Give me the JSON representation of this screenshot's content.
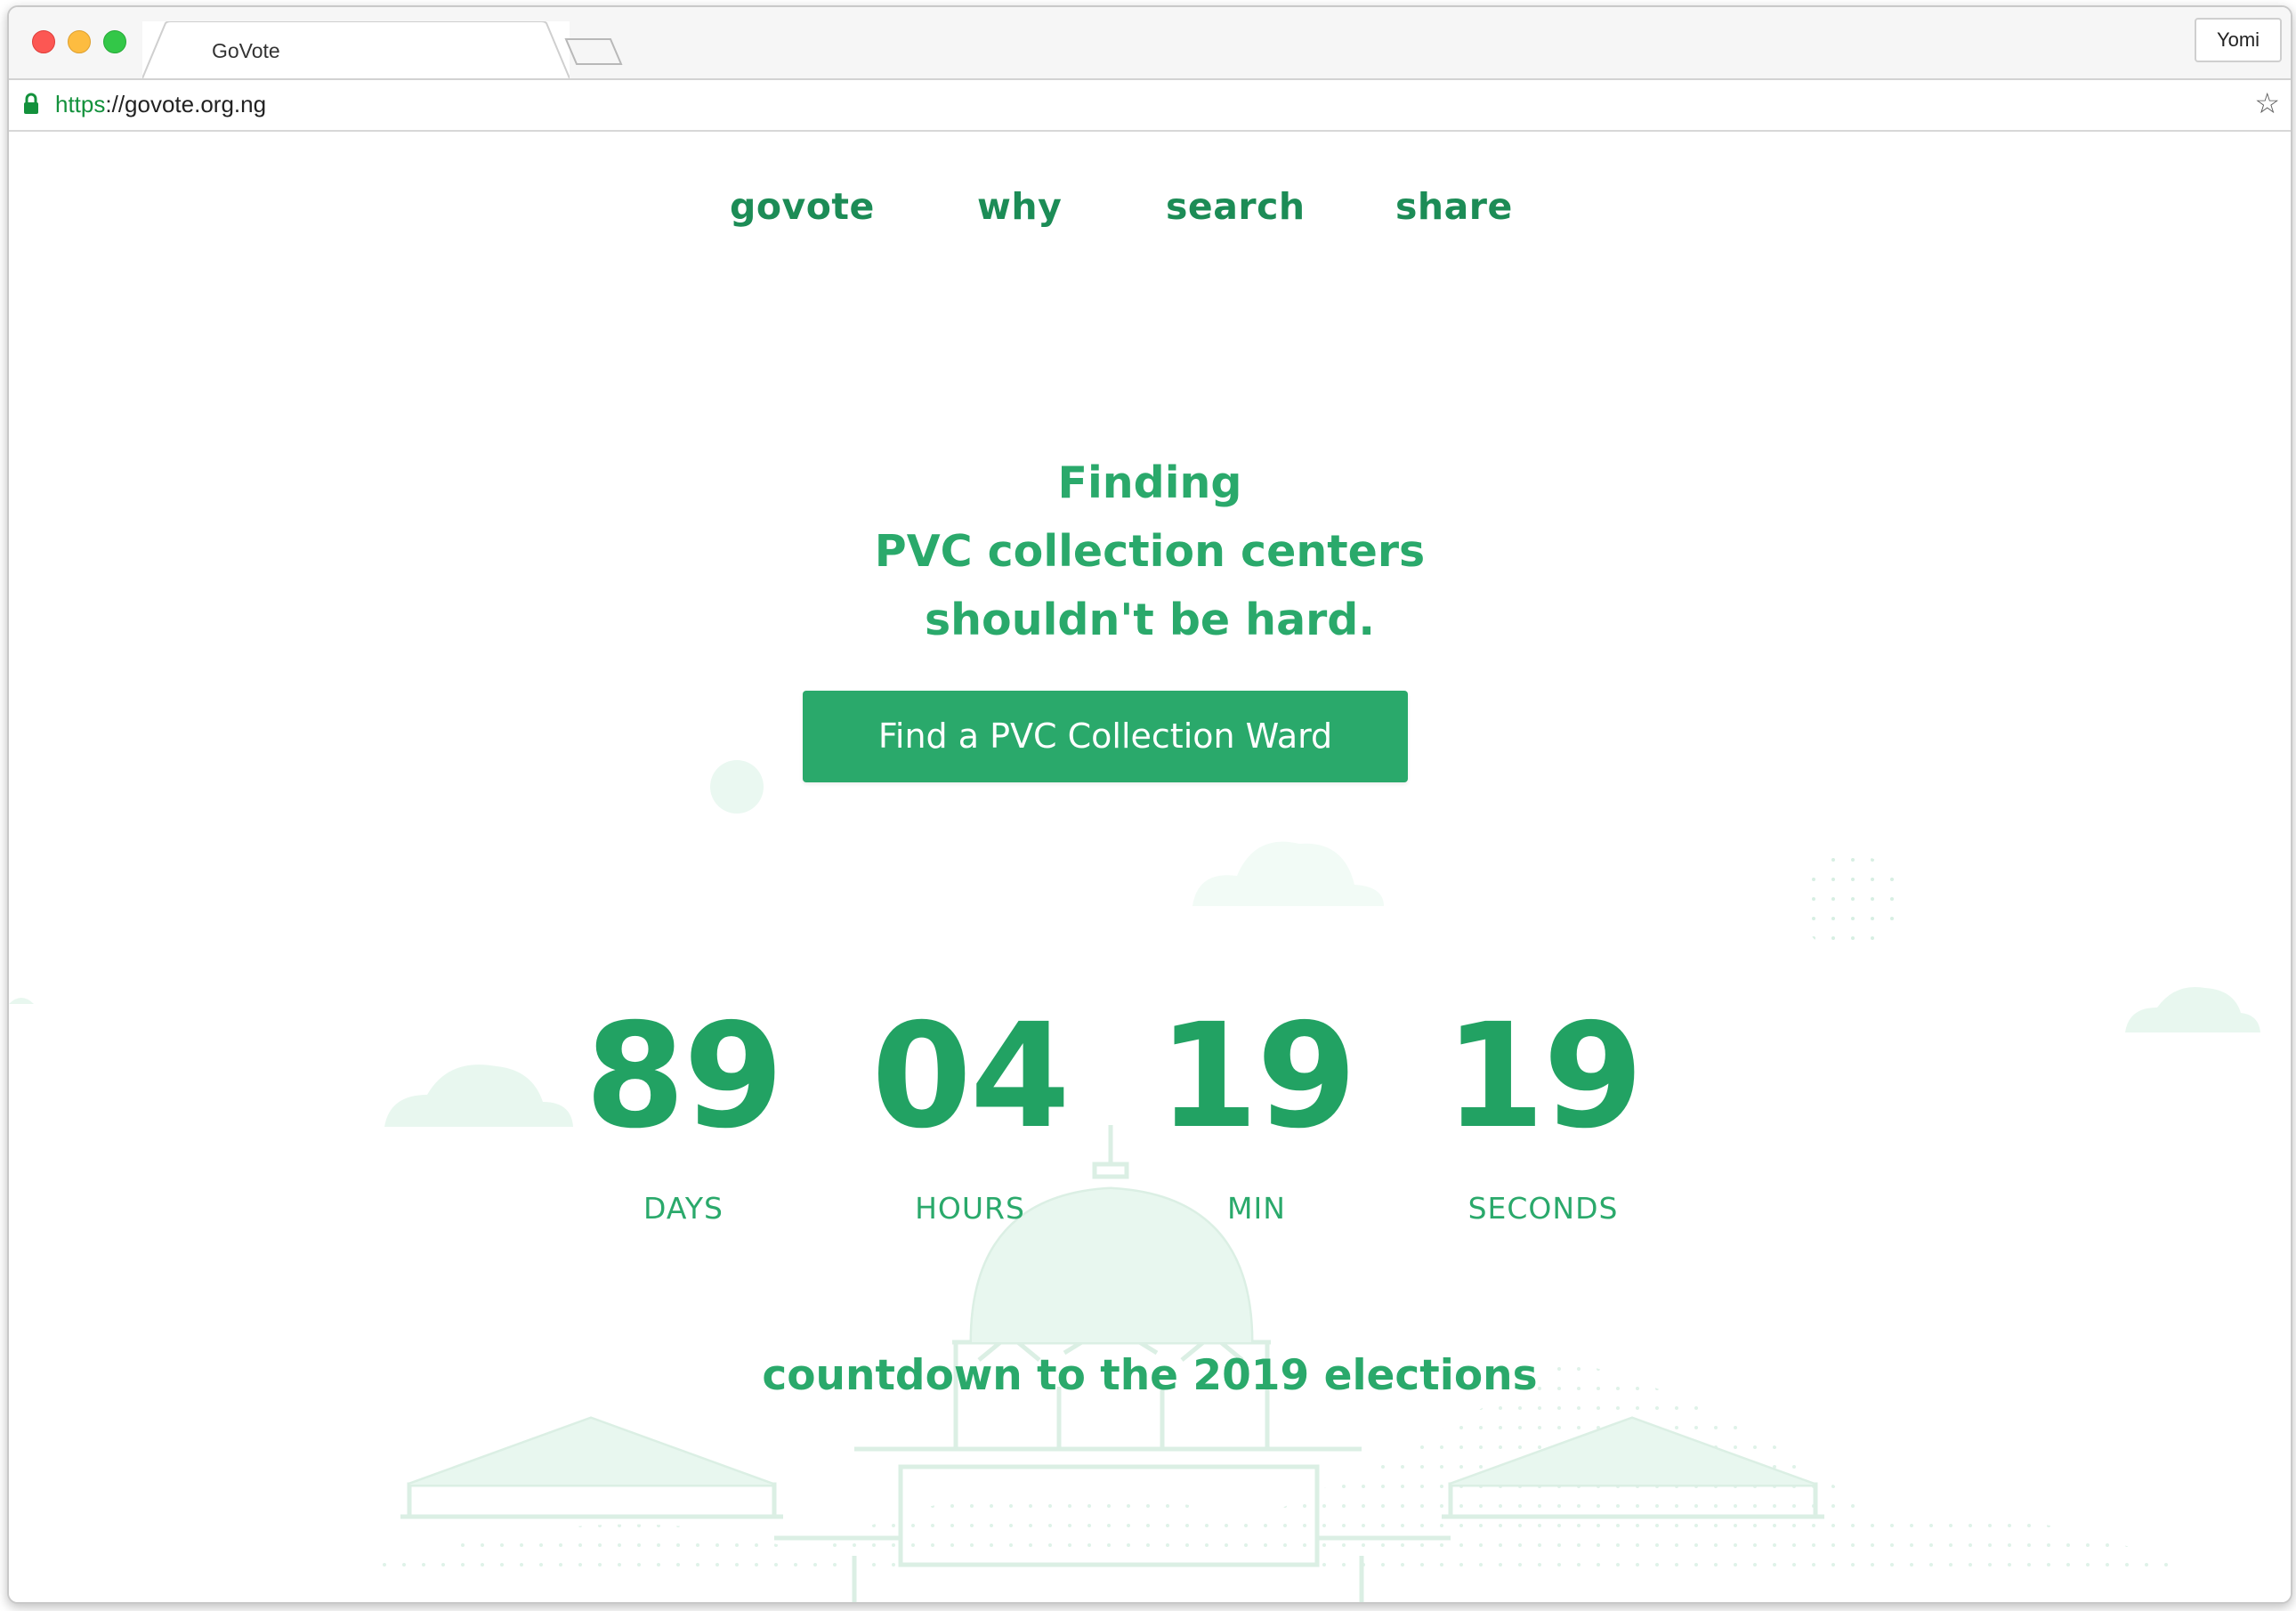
{
  "browser": {
    "tab_title": "GoVote",
    "profile_name": "Yomi",
    "url_scheme": "https",
    "url_rest": "://govote.org.ng"
  },
  "nav": {
    "items": [
      "govote",
      "why",
      "search",
      "share"
    ]
  },
  "hero": {
    "lines": [
      "Finding",
      "PVC collection centers",
      "shouldn't be hard."
    ]
  },
  "cta": {
    "label": "Find a PVC Collection Ward"
  },
  "countdown": {
    "days": "89",
    "hours": "04",
    "minutes": "19",
    "seconds": "19",
    "days_label": "DAYS",
    "hours_label": "HOURS",
    "minutes_label": "MIN",
    "seconds_label": "SECONDS"
  },
  "footer": {
    "note": "countdown to the 2019 elections"
  },
  "colors": {
    "brand_green": "#2aa96b",
    "nav_green": "#1c8c56",
    "art_green": "#e3f5ec"
  }
}
